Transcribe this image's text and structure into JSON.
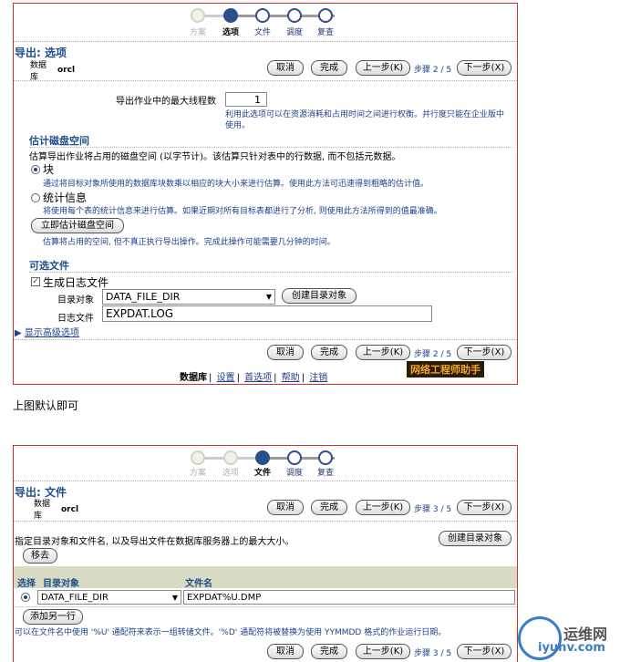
{
  "top": {
    "train": {
      "steps": [
        "方案",
        "选项",
        "文件",
        "调度",
        "复查"
      ]
    },
    "section_title": "导出: 选项",
    "db_label": "数据库",
    "db_value": "orcl",
    "buttons": {
      "cancel": "取消",
      "finish": "完成",
      "back": "上一步(K)",
      "next": "下一步(X)"
    },
    "step_text": "步骤",
    "step_count": "2 / 5",
    "threads_label": "导出作业中的最大线程数",
    "threads_value": "1",
    "threads_note": "利用此选项可以在资源消耗和占用时间之间进行权衡。并行度只能在企业版中使用。",
    "disk_title": "估计磁盘空间",
    "disk_desc": "估算导出作业将占用的磁盘空间 (以字节计)。该估算只针对表中的行数据, 而不包括元数据。",
    "block_label": "块",
    "block_desc": "通过将目标对象所使用的数据库块数乘以相应的块大小来进行估算。使用此方法可迅速得到粗略的估计值。",
    "stats_label": "统计信息",
    "stats_desc": "将使用每个表的统计信息来进行估算。如果近期对所有目标表都进行了分析, 则使用此方法所得到的值最准确。",
    "estimate_btn": "立即估计磁盘空间",
    "estimate_desc": "估算将占用的空间, 但不真正执行导出操作。完成此操作可能需要几分钟的时间。",
    "optional_title": "可选文件",
    "gen_log_label": "生成日志文件",
    "dir_obj_label": "目录对象",
    "dir_obj_value": "DATA_FILE_DIR",
    "create_dir_btn": "创建目录对象",
    "log_file_label": "日志文件",
    "log_file_value": "EXPDAT.LOG",
    "advanced_link": "显示高级选项",
    "footer_links": [
      "数据库",
      "设置",
      "首选项",
      "帮助",
      "注销"
    ],
    "logo_text": "网络工程师助手"
  },
  "caption": "上图默认即可",
  "bottom": {
    "train": {
      "steps": [
        "方案",
        "选项",
        "文件",
        "调度",
        "复查"
      ]
    },
    "section_title": "导出: 文件",
    "db_label": "数据库",
    "db_value": "orcl",
    "buttons": {
      "cancel": "取消",
      "finish": "完成",
      "back": "上一步(K)",
      "next": "下一步(X)"
    },
    "step_text": "步骤",
    "step_count": "3 / 5",
    "desc": "指定目录对象和文件名, 以及导出文件在数据库服务器上的最大大小。",
    "create_dir_btn": "创建目录对象",
    "remove_btn": "移去",
    "col_select": "选择",
    "col_dir": "目录对象",
    "col_file": "文件名",
    "row_dir": "DATA_FILE_DIR",
    "row_file": "EXPDAT%U.DMP",
    "add_btn": "添加另一行",
    "note": "可以在文件名中使用 '%U' 通配符来表示一组转储文件。'%D' 通配符将被替换为使用 YYMMDD 格式的作业运行日期。",
    "watermark_1": "运维网",
    "watermark_2": "iyunv.com"
  },
  "colors": {
    "accent": "#1f4e8c",
    "panel_border": "#cc3333",
    "train_current": "#2a4f8a"
  }
}
